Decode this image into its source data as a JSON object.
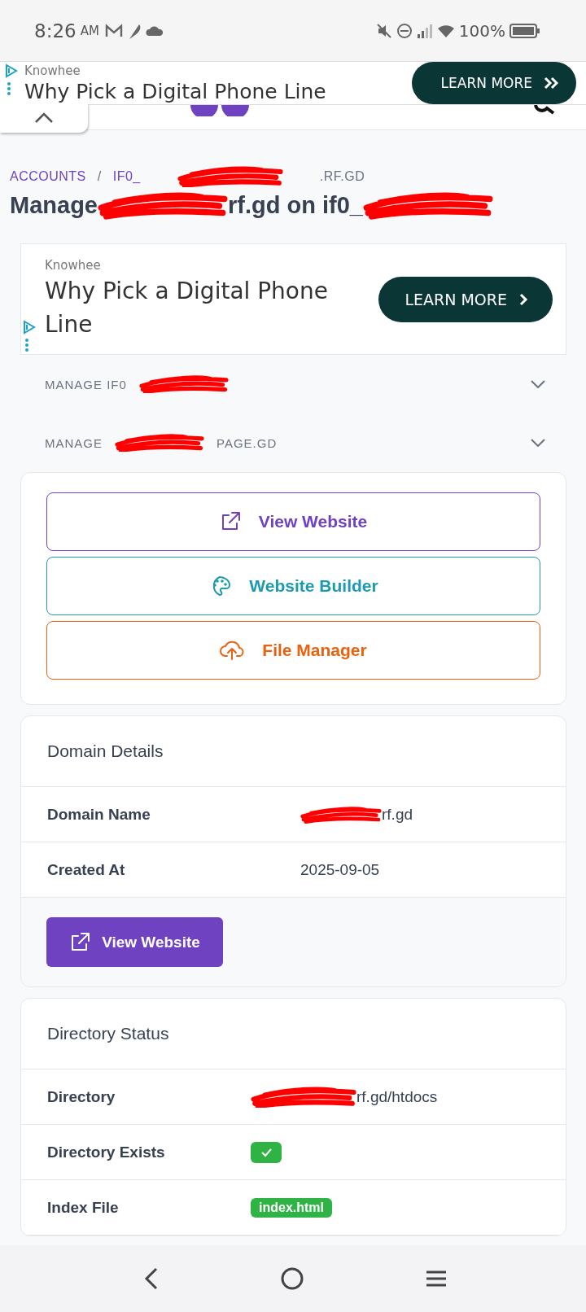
{
  "status_bar": {
    "time": "8:26",
    "ampm": "AM",
    "battery": "100%"
  },
  "top_ad": {
    "advertiser": "Knowhee",
    "headline": "Why Pick a Digital Phone Line",
    "cta": "LEARN MORE"
  },
  "breadcrumb": [
    {
      "kind": "link",
      "text": "ACCOUNTS"
    },
    {
      "kind": "sep",
      "text": "/"
    },
    {
      "kind": "link",
      "text": "IF0_"
    },
    {
      "kind": "redacted"
    },
    {
      "kind": "current",
      "text": ".RF.GD"
    }
  ],
  "title": [
    {
      "kind": "text",
      "text": "Manage"
    },
    {
      "kind": "redacted"
    },
    {
      "kind": "text",
      "text": "rf.gd on if0_"
    },
    {
      "kind": "redacted"
    }
  ],
  "inline_ad": {
    "advertiser": "Knowhee",
    "headline": "Why Pick a Digital Phone Line",
    "cta": "LEARN MORE"
  },
  "accordions": [
    {
      "pieces": [
        {
          "kind": "text",
          "text": "MANAGE IF0"
        },
        {
          "kind": "redacted"
        }
      ],
      "expanded": false
    },
    {
      "pieces": [
        {
          "kind": "text",
          "text": "MANAGE"
        },
        {
          "kind": "redacted"
        },
        {
          "kind": "text",
          "text": "PAGE.GD"
        }
      ],
      "expanded": false
    }
  ],
  "actions": [
    {
      "label": "View Website",
      "kind": "external",
      "color": "#6f42c1"
    },
    {
      "label": "Website Builder",
      "kind": "palette",
      "color": "#1c9bb0"
    },
    {
      "label": "File Manager",
      "kind": "upload",
      "color": "#e8620f"
    }
  ],
  "domain_details": {
    "title": "Domain Details",
    "rows": [
      {
        "label": "Domain Name",
        "kind": "text",
        "pieces": [
          {
            "kind": "redacted"
          },
          {
            "kind": "text",
            "text": "rf.gd"
          }
        ]
      },
      {
        "label": "Created At",
        "kind": "text",
        "pieces": [
          {
            "kind": "text",
            "text": "2025-09-05"
          }
        ]
      }
    ],
    "button": "View Website"
  },
  "directory_status": {
    "title": "Directory Status",
    "rows": [
      {
        "label": "Directory",
        "kind": "text",
        "pieces": [
          {
            "kind": "redacted"
          },
          {
            "kind": "text",
            "text": "rf.gd/htdocs"
          }
        ]
      },
      {
        "label": "Directory Exists",
        "kind": "check",
        "checked": true
      },
      {
        "label": "Index File",
        "kind": "tag",
        "text": "index.html"
      }
    ]
  }
}
